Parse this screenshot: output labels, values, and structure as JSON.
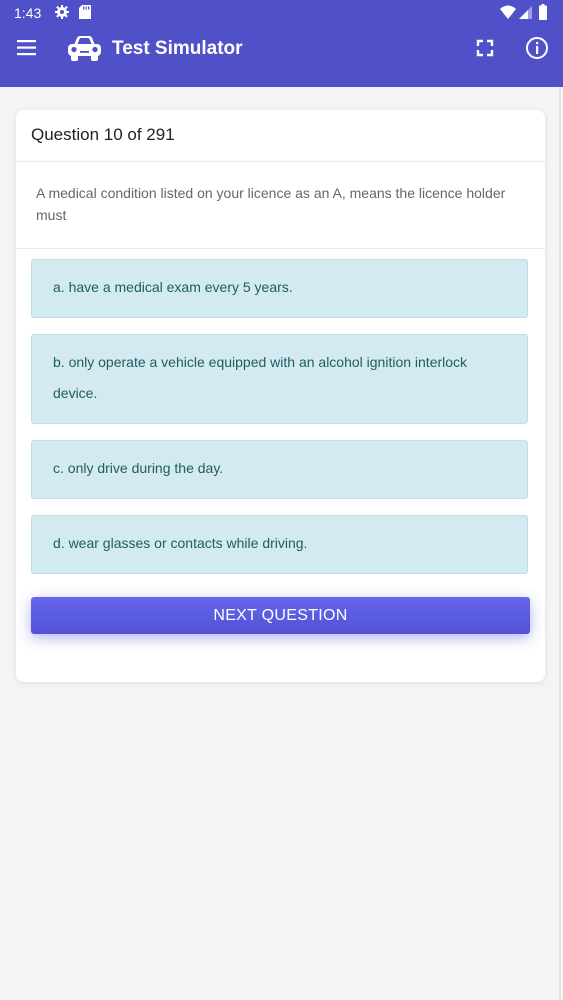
{
  "status_bar": {
    "time": "1:43",
    "icons": [
      "gear-icon",
      "sd-card-icon",
      "wifi-icon",
      "signal-icon",
      "battery-icon"
    ]
  },
  "app_bar": {
    "title": "Test Simulator",
    "icons": [
      "menu-icon",
      "car-icon",
      "fullscreen-icon",
      "info-icon"
    ],
    "color": "#5051c9"
  },
  "question": {
    "counter": "Question 10 of 291",
    "text": "A medical condition listed on your licence as an A, means the licence holder must",
    "answers": [
      {
        "label": "a. have a medical exam every 5 years."
      },
      {
        "label": "b. only operate a vehicle equipped with an alcohol ignition interlock device."
      },
      {
        "label": "c. only drive during the day."
      },
      {
        "label": "d. wear glasses or contacts while driving."
      }
    ],
    "next_label": "NEXT QUESTION"
  },
  "colors": {
    "answer_bg": "#d3ebf0",
    "answer_text": "#1f5c63",
    "button": "#5c5ce0"
  }
}
